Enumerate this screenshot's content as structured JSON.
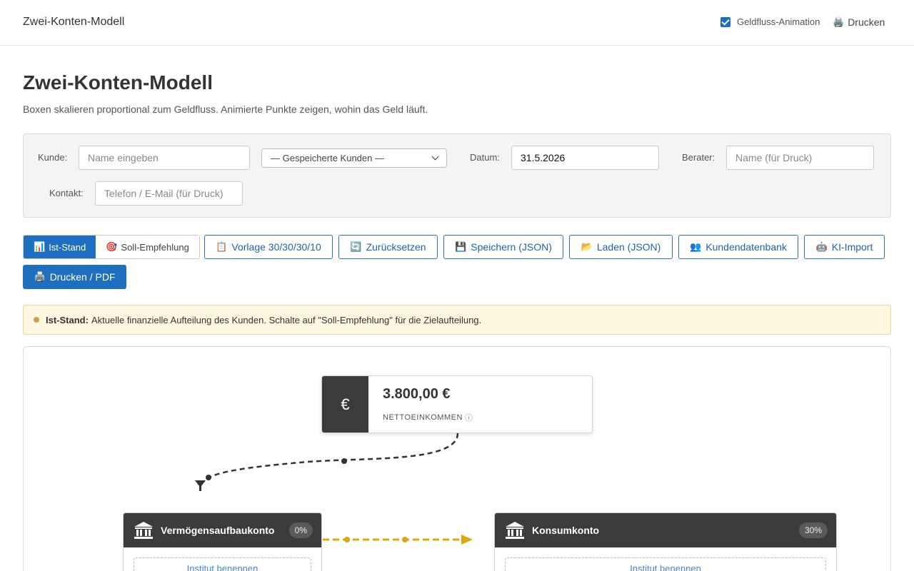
{
  "topbar": {
    "brand": "Zwei-Konten-Modell",
    "animation_label": "Geldfluss-Animation",
    "animation_checked": true,
    "print_label": "Drucken",
    "print_icon": "🖨️"
  },
  "header": {
    "title": "Zwei-Konten-Modell",
    "subtitle": "Boxen skalieren proportional zum Geldfluss. Animierte Punkte zeigen, wohin das Geld läuft."
  },
  "form": {
    "kunde_label": "Kunde:",
    "kunde_placeholder": "Name eingeben",
    "saved_customers_selected": "— Gespeicherte Kunden —",
    "datum_label": "Datum:",
    "datum_value": "31.5.2026",
    "berater_label": "Berater:",
    "berater_placeholder": "Name (für Druck)",
    "kontakt_label": "Kontakt:",
    "kontakt_placeholder": "Telefon / E-Mail (für Druck)"
  },
  "mode": {
    "ist": {
      "icon": "📊",
      "label": "Ist-Stand"
    },
    "soll": {
      "icon": "🎯",
      "label": "Soll-Empfehlung"
    }
  },
  "toolbar": {
    "vorlage": {
      "icon": "📋",
      "label": "Vorlage 30/30/30/10"
    },
    "reset": {
      "icon": "🔄",
      "label": "Zurücksetzen"
    },
    "save": {
      "icon": "💾",
      "label": "Speichern (JSON)"
    },
    "load": {
      "icon": "📂",
      "label": "Laden (JSON)"
    },
    "db": {
      "icon": "👥",
      "label": "Kundendatenbank"
    },
    "ki": {
      "icon": "🤖",
      "label": "KI-Import"
    },
    "print": {
      "icon": "🖨️",
      "label": "Drucken / PDF"
    }
  },
  "notice": {
    "bold": "Ist-Stand:",
    "text": "Aktuelle finanzielle Aufteilung des Kunden. Schalte auf \"Soll-Empfehlung\" für die Zielaufteilung."
  },
  "income": {
    "symbol": "€",
    "amount": "3.800,00 €",
    "label": "NETTOEINKOMMEN",
    "info_icon": "ⓘ"
  },
  "accounts": [
    {
      "name": "Vermögensaufbaukonto",
      "percent": "0%",
      "institute_placeholder": "Institut benennen"
    },
    {
      "name": "Konsumkonto",
      "percent": "30%",
      "institute_placeholder": "Institut benennen"
    }
  ],
  "colors": {
    "primary": "#1f6fc0",
    "dark": "#3b3b3b",
    "flow_accent": "#d9a90f",
    "notice_bg": "#fff8e1"
  }
}
